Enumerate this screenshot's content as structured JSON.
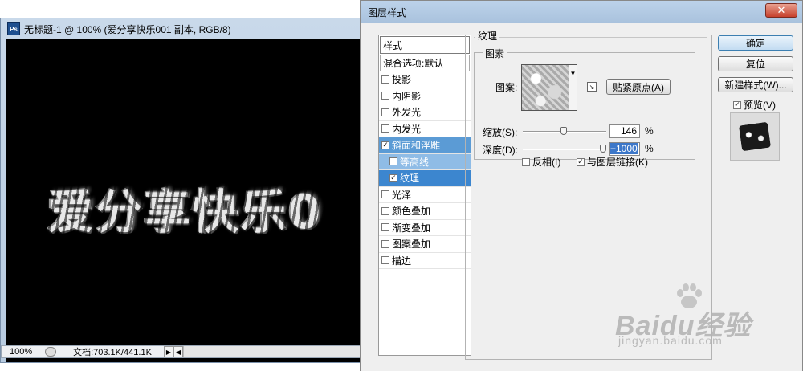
{
  "document": {
    "title": "无标题-1 @ 100% (爱分享快乐001 副本, RGB/8)",
    "app_icon": "Ps",
    "canvas_text": "爱分享快乐0",
    "zoom": "100%",
    "doc_info": "文档:703.1K/441.1K"
  },
  "dialog": {
    "title": "图层样式",
    "close_symbol": "✕",
    "styles_header": "样式",
    "blend_options": "混合选项:默认",
    "items": [
      {
        "label": "投影",
        "checked": false
      },
      {
        "label": "内阴影",
        "checked": false
      },
      {
        "label": "外发光",
        "checked": false
      },
      {
        "label": "内发光",
        "checked": false
      },
      {
        "label": "斜面和浮雕",
        "checked": true
      },
      {
        "label": "等高线",
        "checked": false
      },
      {
        "label": "纹理",
        "checked": true
      },
      {
        "label": "光泽",
        "checked": false
      },
      {
        "label": "颜色叠加",
        "checked": false
      },
      {
        "label": "渐变叠加",
        "checked": false
      },
      {
        "label": "图案叠加",
        "checked": false
      },
      {
        "label": "描边",
        "checked": false
      }
    ],
    "panel": {
      "section_title": "纹理",
      "group_title": "图素",
      "pattern_label": "图案:",
      "snap_button": "贴紧原点(A)",
      "scale_label": "缩放(S):",
      "scale_value": "146",
      "scale_fraction": 0.49,
      "depth_label": "深度(D):",
      "depth_value": "+1000",
      "depth_fraction": 1.0,
      "percent": "%",
      "invert_label": "反相(I)",
      "invert_checked": false,
      "link_label": "与图层链接(K)",
      "link_checked": true
    },
    "buttons": {
      "ok": "确定",
      "reset": "复位",
      "new_style": "新建样式(W)...",
      "preview": "预览(V)",
      "preview_checked": true
    }
  },
  "watermark": {
    "brand": "Baidu经验",
    "url": "jingyan.baidu.com"
  }
}
